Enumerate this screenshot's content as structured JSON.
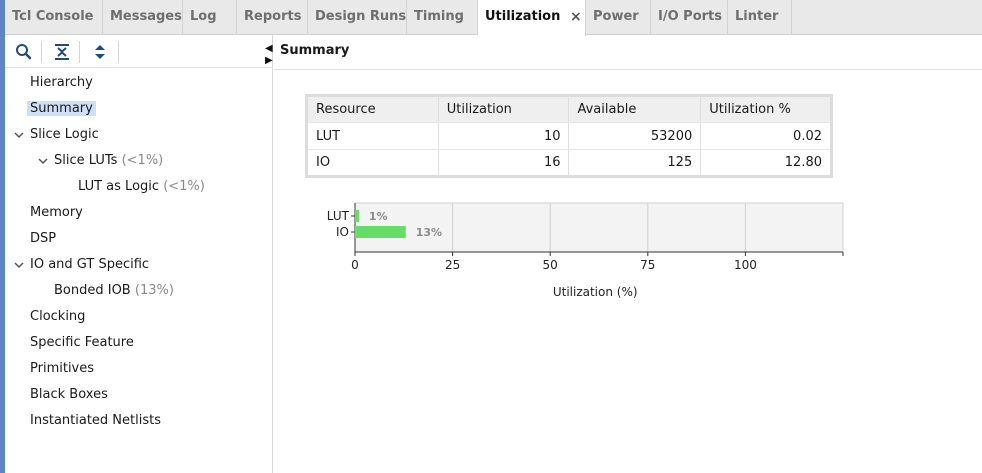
{
  "tabs": [
    {
      "label": "Tcl Console",
      "active": false
    },
    {
      "label": "Messages",
      "active": false
    },
    {
      "label": "Log",
      "active": false
    },
    {
      "label": "Reports",
      "active": false
    },
    {
      "label": "Design Runs",
      "active": false
    },
    {
      "label": "Timing",
      "active": false
    },
    {
      "label": "Utilization",
      "active": true
    },
    {
      "label": "Power",
      "active": false
    },
    {
      "label": "I/O Ports",
      "active": false
    },
    {
      "label": "Linter",
      "active": false
    }
  ],
  "close_glyph": "×",
  "toolbar_icons": [
    "search-icon",
    "collapse-all-icon",
    "expand-all-icon"
  ],
  "tree": {
    "items": [
      {
        "label": "Hierarchy",
        "suffix": "",
        "expandable": false,
        "selected": false
      },
      {
        "label": "Summary",
        "suffix": "",
        "expandable": false,
        "selected": true
      },
      {
        "label": "Slice Logic",
        "suffix": "",
        "expandable": true,
        "selected": false
      },
      {
        "label": "Slice LUTs",
        "suffix": "(<1%)",
        "expandable": true,
        "selected": false
      },
      {
        "label": "LUT as Logic",
        "suffix": "(<1%)",
        "expandable": false,
        "selected": false
      },
      {
        "label": "Memory",
        "suffix": "",
        "expandable": false,
        "selected": false
      },
      {
        "label": "DSP",
        "suffix": "",
        "expandable": false,
        "selected": false
      },
      {
        "label": "IO and GT Specific",
        "suffix": "",
        "expandable": true,
        "selected": false
      },
      {
        "label": "Bonded IOB",
        "suffix": "(13%)",
        "expandable": false,
        "selected": false
      },
      {
        "label": "Clocking",
        "suffix": "",
        "expandable": false,
        "selected": false
      },
      {
        "label": "Specific Feature",
        "suffix": "",
        "expandable": false,
        "selected": false
      },
      {
        "label": "Primitives",
        "suffix": "",
        "expandable": false,
        "selected": false
      },
      {
        "label": "Black Boxes",
        "suffix": "",
        "expandable": false,
        "selected": false
      },
      {
        "label": "Instantiated Netlists",
        "suffix": "",
        "expandable": false,
        "selected": false
      }
    ]
  },
  "main": {
    "title": "Summary",
    "table": {
      "columns": [
        "Resource",
        "Utilization",
        "Available",
        "Utilization %"
      ],
      "rows": [
        [
          "LUT",
          "10",
          "53200",
          "0.02"
        ],
        [
          "IO",
          "16",
          "125",
          "12.80"
        ]
      ]
    }
  },
  "colors": {
    "bar": "#66dd66",
    "selected": "#cde0f7",
    "accent_strip": "#5e86c4"
  },
  "chart_data": {
    "type": "bar",
    "orientation": "horizontal",
    "categories": [
      "LUT",
      "IO"
    ],
    "values": [
      1,
      13
    ],
    "value_labels": [
      "1%",
      "13%"
    ],
    "xlabel": "Utilization (%)",
    "xticks": [
      0,
      25,
      50,
      75,
      100
    ],
    "xlim": [
      0,
      125
    ],
    "grid": true
  }
}
